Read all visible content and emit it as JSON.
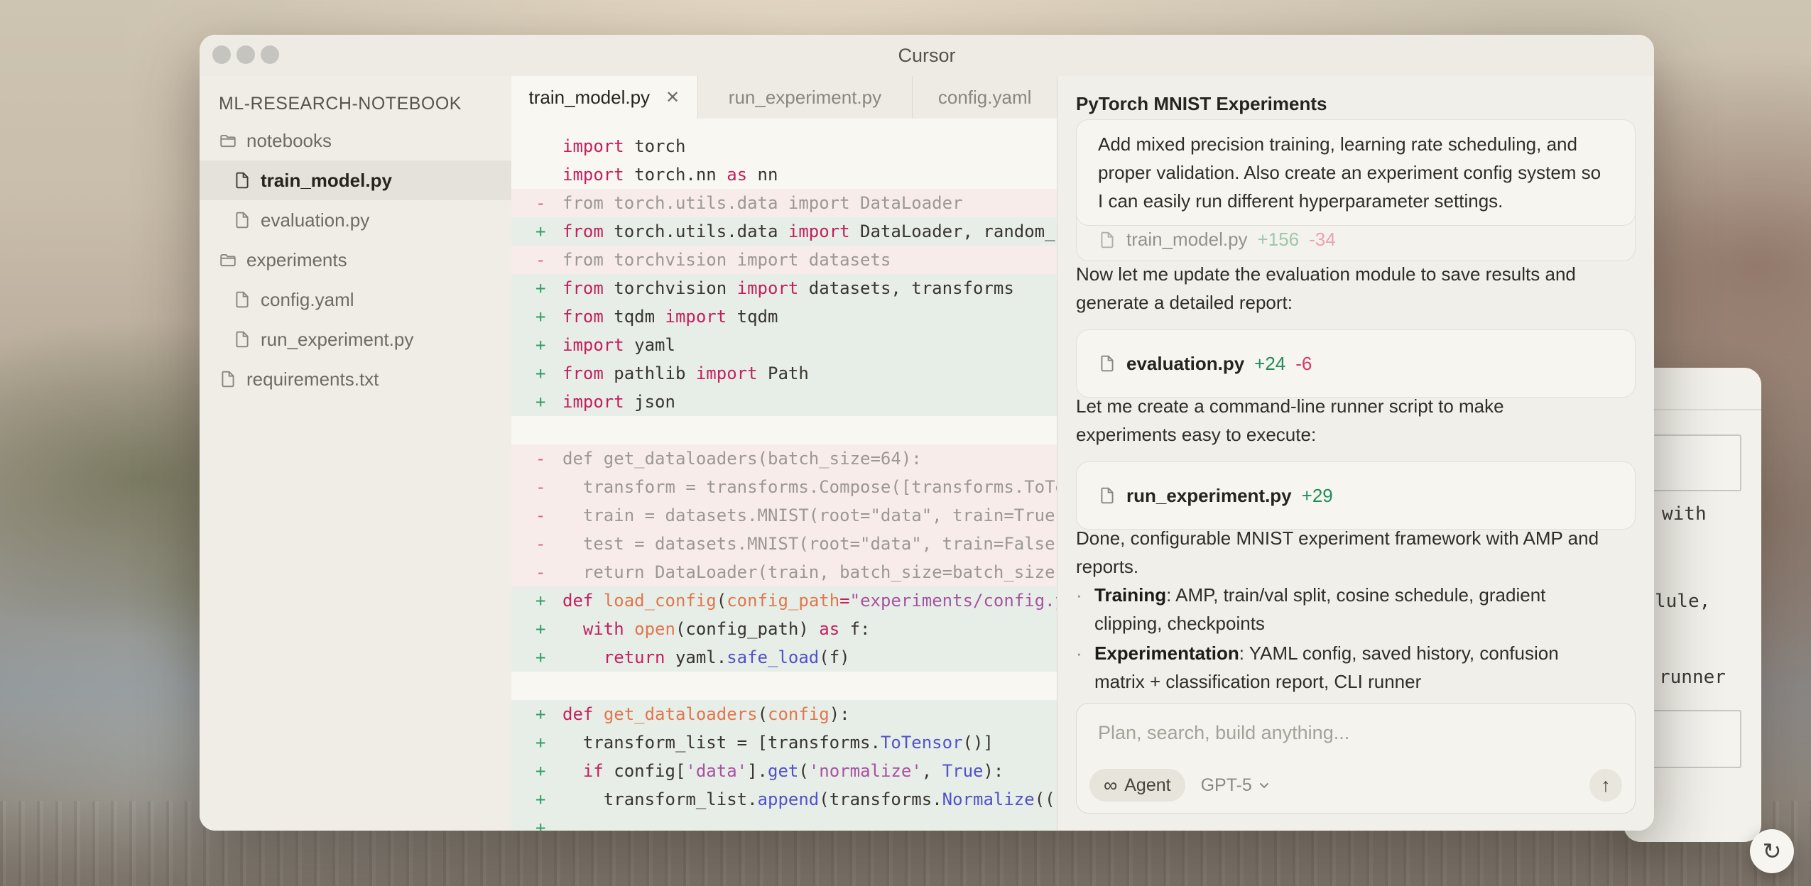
{
  "window": {
    "title": "Cursor"
  },
  "sidebar": {
    "header": "ML-RESEARCH-NOTEBOOK",
    "items": [
      {
        "label": "notebooks",
        "kind": "folder",
        "level": 0,
        "selected": false
      },
      {
        "label": "train_model.py",
        "kind": "file",
        "level": 1,
        "selected": true
      },
      {
        "label": "evaluation.py",
        "kind": "file",
        "level": 1,
        "selected": false
      },
      {
        "label": "experiments",
        "kind": "folder",
        "level": 0,
        "selected": false
      },
      {
        "label": "config.yaml",
        "kind": "file",
        "level": 1,
        "selected": false
      },
      {
        "label": "run_experiment.py",
        "kind": "file",
        "level": 1,
        "selected": false
      },
      {
        "label": "requirements.txt",
        "kind": "file",
        "level": 0,
        "selected": false
      }
    ]
  },
  "tabs": [
    {
      "label": "train_model.py",
      "active": true,
      "close_icon": "✕"
    },
    {
      "label": "run_experiment.py",
      "active": false
    },
    {
      "label": "config.yaml",
      "active": false
    }
  ],
  "editor": {
    "lines": [
      {
        "t": "ctx",
        "tk": [
          [
            "kw",
            "import"
          ],
          [
            "pl",
            " torch"
          ]
        ]
      },
      {
        "t": "ctx",
        "tk": [
          [
            "kw",
            "import"
          ],
          [
            "pl",
            " torch.nn "
          ],
          [
            "kw",
            "as"
          ],
          [
            "pl",
            " nn"
          ]
        ]
      },
      {
        "t": "del",
        "text": "from torch.utils.data import DataLoader"
      },
      {
        "t": "add",
        "tk": [
          [
            "kw",
            "from"
          ],
          [
            "pl",
            " torch.utils.data "
          ],
          [
            "kw",
            "import"
          ],
          [
            "pl",
            " DataLoader, random_spl"
          ]
        ]
      },
      {
        "t": "del",
        "text": "from torchvision import datasets"
      },
      {
        "t": "add",
        "tk": [
          [
            "kw",
            "from"
          ],
          [
            "pl",
            " torchvision "
          ],
          [
            "kw",
            "import"
          ],
          [
            "pl",
            " datasets, transforms"
          ]
        ]
      },
      {
        "t": "add",
        "tk": [
          [
            "kw",
            "from"
          ],
          [
            "pl",
            " tqdm "
          ],
          [
            "kw",
            "import"
          ],
          [
            "pl",
            " tqdm"
          ]
        ]
      },
      {
        "t": "add",
        "tk": [
          [
            "kw",
            "import"
          ],
          [
            "pl",
            " yaml"
          ]
        ]
      },
      {
        "t": "add",
        "tk": [
          [
            "kw",
            "from"
          ],
          [
            "pl",
            " pathlib "
          ],
          [
            "kw",
            "import"
          ],
          [
            "pl",
            " Path"
          ]
        ]
      },
      {
        "t": "add",
        "tk": [
          [
            "kw",
            "import"
          ],
          [
            "pl",
            " json"
          ]
        ]
      },
      {
        "t": "gap"
      },
      {
        "t": "del",
        "text": "def get_dataloaders(batch_size=64):"
      },
      {
        "t": "del",
        "text": "  transform = transforms.Compose([transforms.ToTen"
      },
      {
        "t": "del",
        "text": "  train = datasets.MNIST(root=\"data\", train=True,"
      },
      {
        "t": "del",
        "text": "  test = datasets.MNIST(root=\"data\", train=False,"
      },
      {
        "t": "del",
        "text": "  return DataLoader(train, batch_size=batch_size, s"
      },
      {
        "t": "add",
        "tk": [
          [
            "kw",
            "def"
          ],
          [
            "pl",
            " "
          ],
          [
            "fn",
            "load_config"
          ],
          [
            "pl",
            "("
          ],
          [
            "fn",
            "config_path"
          ],
          [
            "kw",
            "="
          ],
          [
            "str",
            "\"experiments/config.ya"
          ]
        ]
      },
      {
        "t": "add",
        "tk": [
          [
            "pl",
            "  "
          ],
          [
            "kw",
            "with"
          ],
          [
            "pl",
            " "
          ],
          [
            "fn",
            "open"
          ],
          [
            "pl",
            "(config_path) "
          ],
          [
            "kw",
            "as"
          ],
          [
            "pl",
            " f:"
          ]
        ]
      },
      {
        "t": "add",
        "tk": [
          [
            "pl",
            "    "
          ],
          [
            "kw",
            "return"
          ],
          [
            "pl",
            " yaml."
          ],
          [
            "bl",
            "safe_load"
          ],
          [
            "pl",
            "(f)"
          ]
        ]
      },
      {
        "t": "gap"
      },
      {
        "t": "add",
        "tk": [
          [
            "kw",
            "def"
          ],
          [
            "pl",
            " "
          ],
          [
            "fn",
            "get_dataloaders"
          ],
          [
            "pl",
            "("
          ],
          [
            "fn",
            "config"
          ],
          [
            "pl",
            "):"
          ]
        ]
      },
      {
        "t": "add",
        "tk": [
          [
            "pl",
            "  transform_list = [transforms."
          ],
          [
            "bl",
            "ToTensor"
          ],
          [
            "pl",
            "()]"
          ]
        ]
      },
      {
        "t": "add",
        "tk": [
          [
            "pl",
            "  "
          ],
          [
            "kw",
            "if"
          ],
          [
            "pl",
            " config["
          ],
          [
            "str",
            "'data'"
          ],
          [
            "pl",
            "]."
          ],
          [
            "bl",
            "get"
          ],
          [
            "pl",
            "("
          ],
          [
            "str",
            "'normalize'"
          ],
          [
            "pl",
            ", "
          ],
          [
            "bl",
            "True"
          ],
          [
            "pl",
            "):"
          ]
        ]
      },
      {
        "t": "add",
        "tk": [
          [
            "pl",
            "    transform_list."
          ],
          [
            "bl",
            "append"
          ],
          [
            "pl",
            "(transforms."
          ],
          [
            "bl",
            "Normalize"
          ],
          [
            "pl",
            "(("
          ]
        ]
      },
      {
        "t": "add",
        "tk": [
          [
            "pl",
            ""
          ]
        ]
      }
    ]
  },
  "chat": {
    "title": "PyTorch MNIST Experiments",
    "blocks": [
      {
        "kind": "chip",
        "file": "train_model.py",
        "added": "+156",
        "removed": "-34",
        "faded": true
      },
      {
        "kind": "user",
        "lines": [
          "Add mixed precision training, learning rate scheduling, and",
          "proper validation. Also create an experiment config system so",
          "I can easily run different hyperparameter settings."
        ]
      },
      {
        "kind": "para",
        "lines": [
          "Now let me update the evaluation module to save results and",
          "generate a detailed report:"
        ]
      },
      {
        "kind": "chip",
        "file": "evaluation.py",
        "added": "+24",
        "removed": "-6",
        "faded": false
      },
      {
        "kind": "para",
        "lines": [
          "Let me create a command-line runner script to make",
          "experiments easy to execute:"
        ]
      },
      {
        "kind": "chip",
        "file": "run_experiment.py",
        "added": "+29",
        "removed": "",
        "faded": false
      },
      {
        "kind": "para",
        "lines": [
          "Done, configurable MNIST experiment framework with AMP and",
          "reports."
        ]
      },
      {
        "kind": "bullet",
        "bold": "Training",
        "first_rest": ": AMP, train/val split, cosine schedule, gradient",
        "rest_lines": [
          "clipping, checkpoints"
        ]
      },
      {
        "kind": "bullet",
        "bold": "Experimentation",
        "first_rest": ": YAML config, saved history, confusion",
        "rest_lines": [
          "matrix + classification report, CLI runner"
        ]
      }
    ],
    "input": {
      "placeholder": "Plan, search, build anything...",
      "agent_label": "Agent",
      "agent_icon": "∞",
      "model_label": "GPT-5",
      "send_icon": "↑"
    }
  },
  "bg_window": {
    "fragments": [
      "with",
      "lule,",
      "runner"
    ]
  },
  "fab": {
    "refresh_icon": "↻"
  },
  "colors": {
    "diff_added_text": "#1e8e5a",
    "diff_removed_text": "#d63964",
    "diff_added_bg": "#e7eee7",
    "diff_removed_bg": "#f7ecea",
    "keyword": "#c41f5e",
    "function": "#e0764d",
    "string": "#a852a2",
    "builtin": "#5151cc"
  }
}
